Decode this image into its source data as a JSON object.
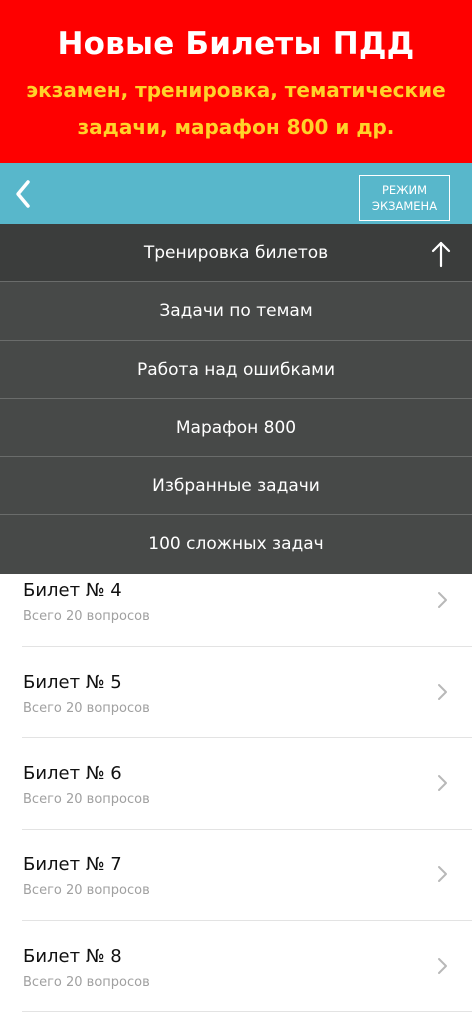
{
  "promo": {
    "title": "Новые Билеты ПДД",
    "subtitle_line1": "экзамен, тренировка, тематические",
    "subtitle_line2": "задачи, марафон 800 и др."
  },
  "navbar": {
    "back_icon": "chevron-left-icon",
    "mode_button_line1": "РЕЖИМ",
    "mode_button_line2": "ЭКЗАМЕНА"
  },
  "menu": {
    "items": [
      {
        "label": "Тренировка билетов"
      },
      {
        "label": "Задачи по темам"
      },
      {
        "label": "Работа над ошибками"
      },
      {
        "label": "Марафон 800"
      },
      {
        "label": "Избранные задачи"
      },
      {
        "label": "100 сложных задач"
      }
    ],
    "collapse_icon": "arrow-up-icon"
  },
  "tickets": [
    {
      "title": "Билет № 4",
      "subtitle": "Всего 20 вопросов"
    },
    {
      "title": "Билет № 5",
      "subtitle": "Всего 20 вопросов"
    },
    {
      "title": "Билет № 6",
      "subtitle": "Всего 20 вопросов"
    },
    {
      "title": "Билет № 7",
      "subtitle": "Всего 20 вопросов"
    },
    {
      "title": "Билет № 8",
      "subtitle": "Всего 20 вопросов"
    }
  ],
  "colors": {
    "promo_bg": "#fe0000",
    "promo_subtitle": "#ffd22a",
    "navbar_bg": "#58b7cb",
    "menu_bg": "#474948"
  }
}
